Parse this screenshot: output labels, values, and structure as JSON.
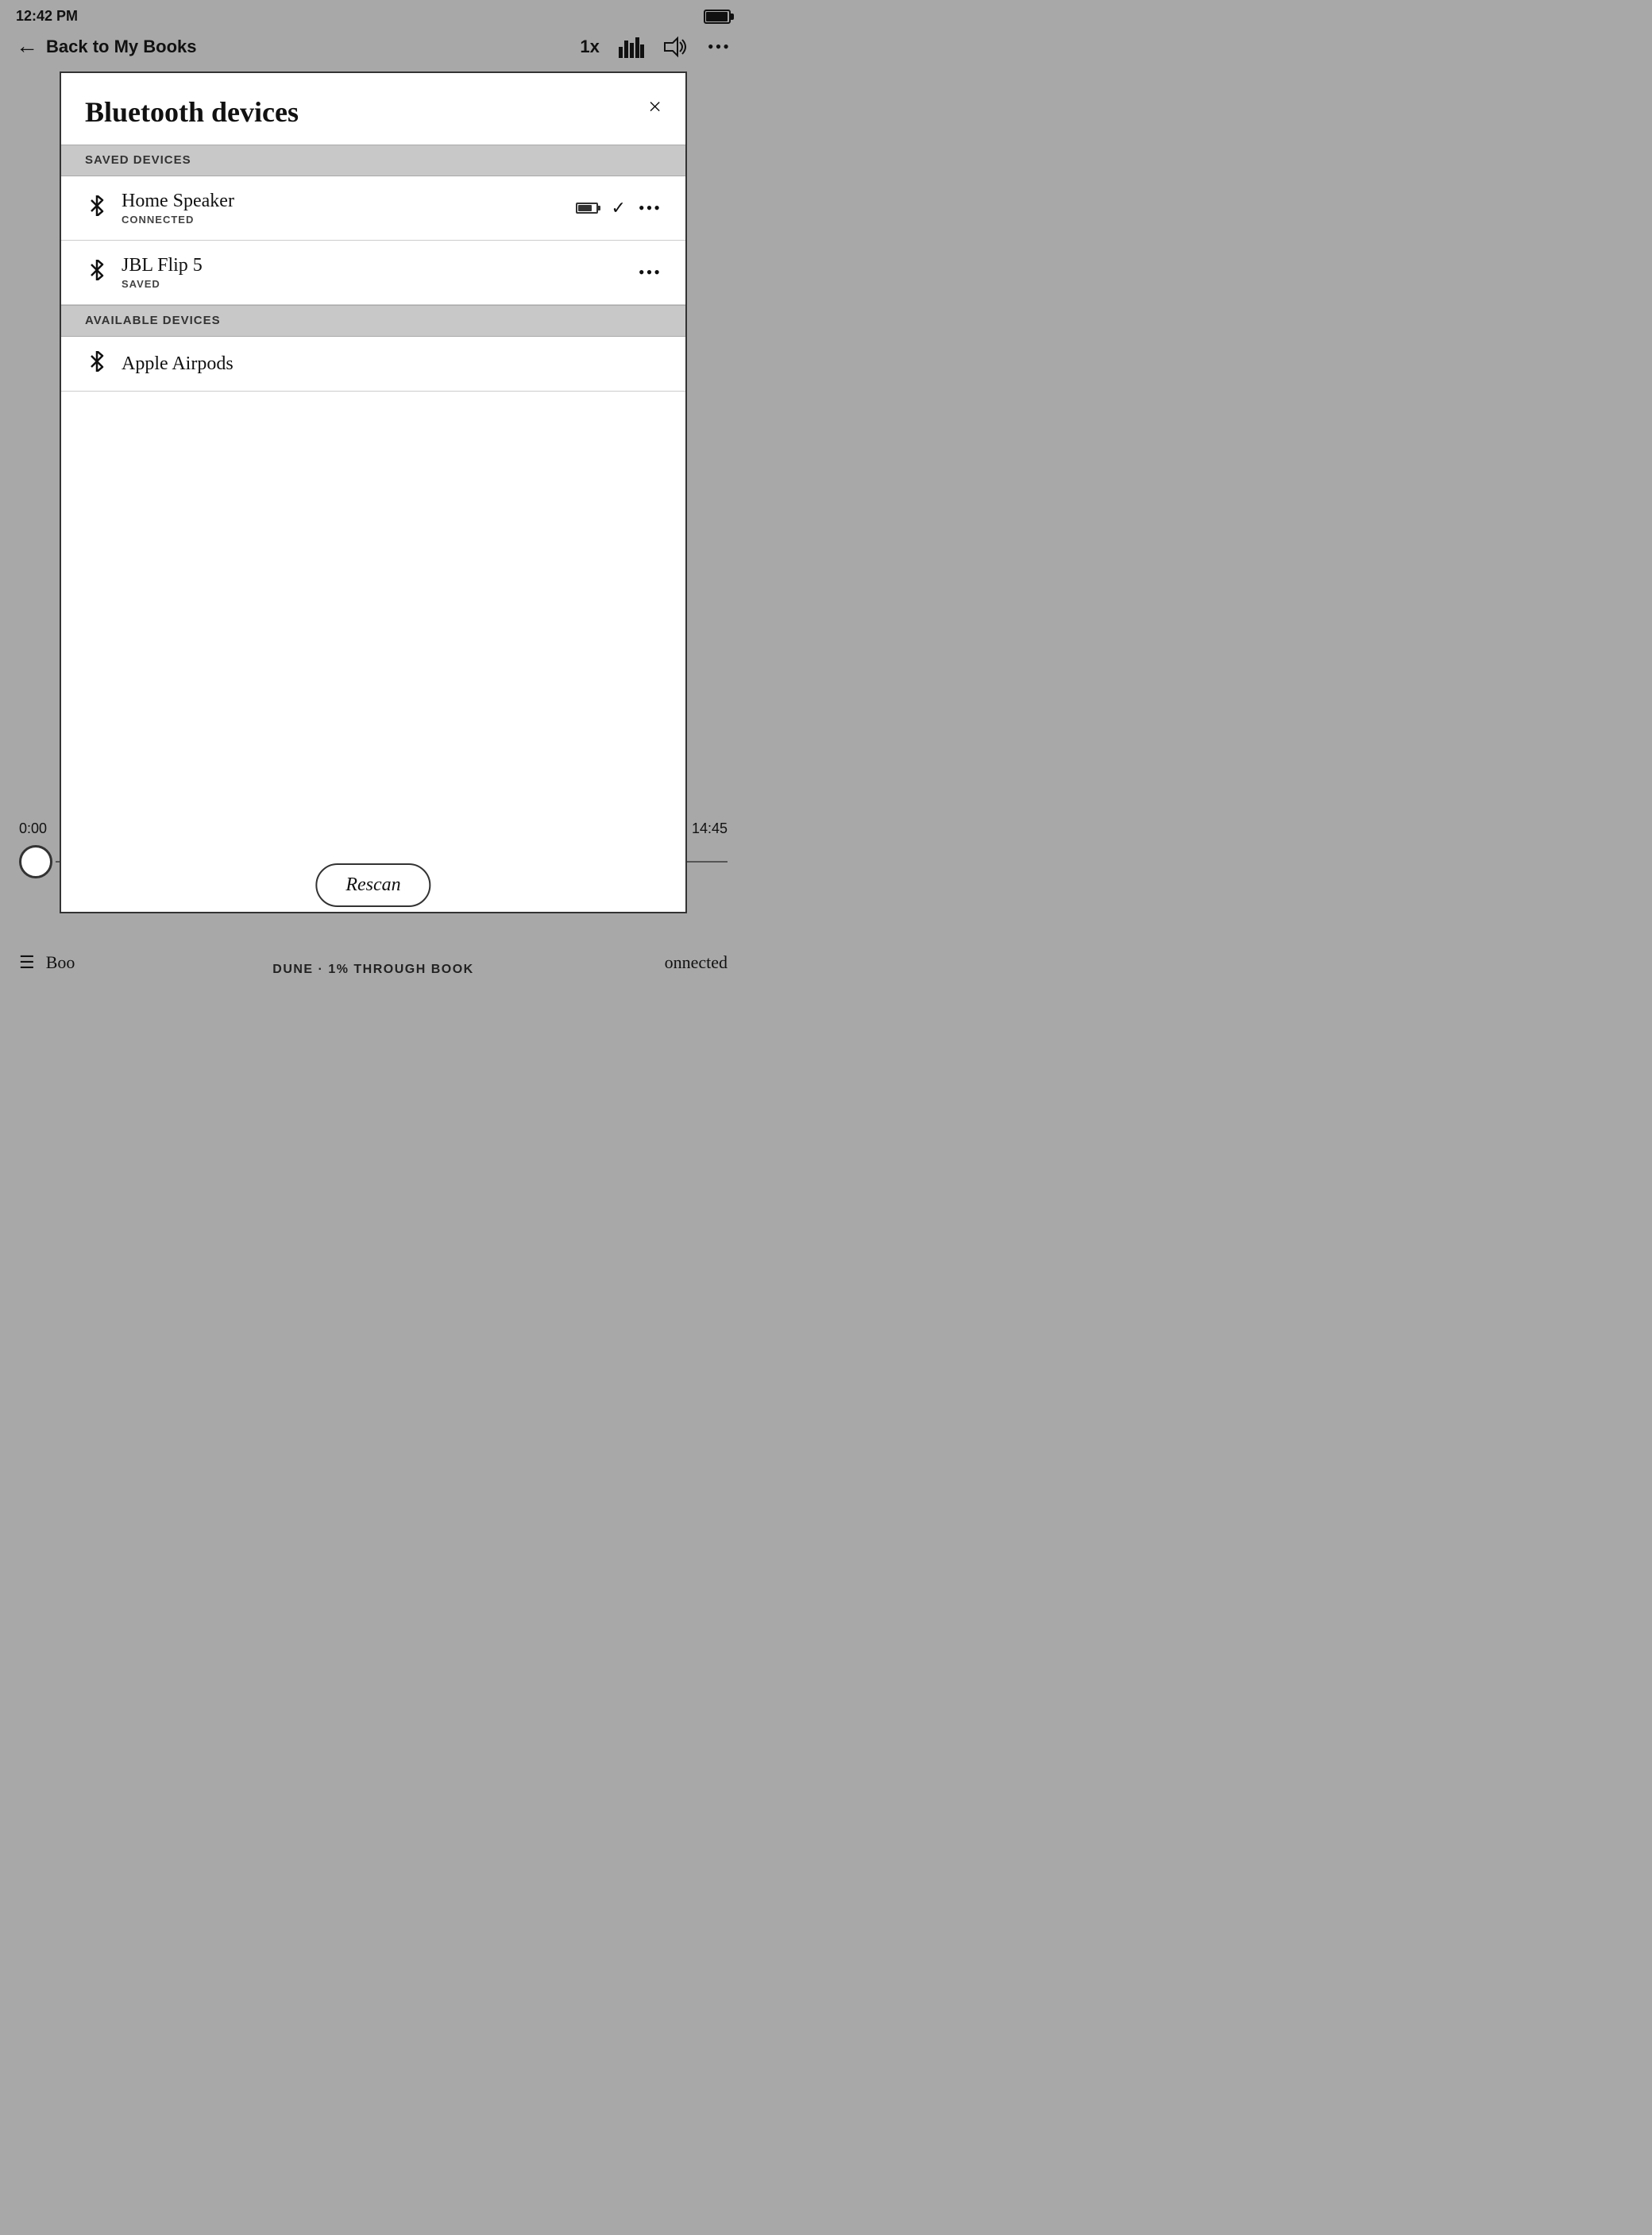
{
  "statusBar": {
    "time": "12:42 PM"
  },
  "navBar": {
    "backLabel": "Back to My Books",
    "speed": "1x",
    "icons": {
      "bars": "bars-icon",
      "volume": "volume-icon",
      "more": "more-icon"
    }
  },
  "modal": {
    "title": "Bluetooth devices",
    "closeLabel": "×",
    "savedDevicesHeader": "SAVED DEVICES",
    "availableDevicesHeader": "AVAILABLE DEVICES",
    "savedDevices": [
      {
        "name": "Home Speaker",
        "status": "CONNECTED",
        "hasBattery": true,
        "hasCheck": true,
        "hasMenu": true
      },
      {
        "name": "JBL Flip 5",
        "status": "SAVED",
        "hasBattery": false,
        "hasCheck": false,
        "hasMenu": true
      }
    ],
    "availableDevices": [
      {
        "name": "Apple Airpods",
        "hasBattery": false,
        "hasCheck": false,
        "hasMenu": false
      }
    ]
  },
  "playback": {
    "currentTime": "0:00",
    "totalTime": "14:45"
  },
  "rescanButton": "Rescan",
  "bottomNav": {
    "bookLabel": "Boo",
    "connected": "onnected"
  },
  "bookProgress": "DUNE · 1% THROUGH BOOK"
}
